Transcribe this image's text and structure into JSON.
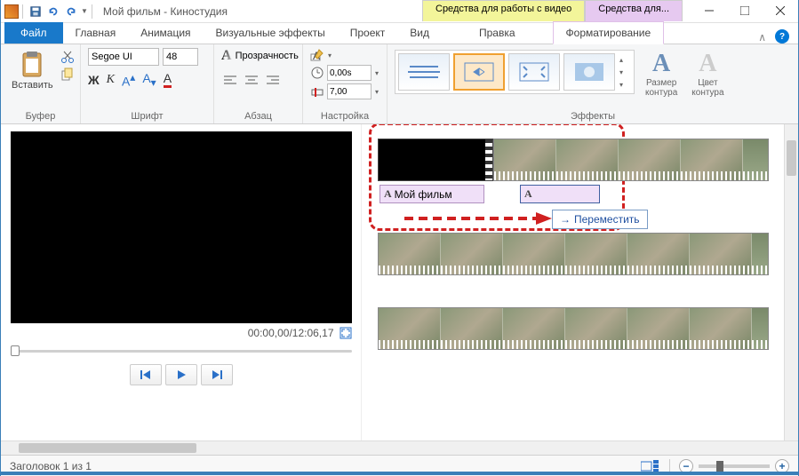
{
  "title": "Мой фильм - Киностудия",
  "context_tabs": {
    "video": "Средства для работы с видео",
    "text": "Средства для..."
  },
  "tabs": {
    "file": "Файл",
    "home": "Главная",
    "anim": "Анимация",
    "vfx": "Визуальные эффекты",
    "project": "Проект",
    "view": "Вид",
    "edit": "Правка",
    "format": "Форматирование"
  },
  "groups": {
    "buffer": "Буфер",
    "font": "Шрифт",
    "para": "Абзац",
    "adjust": "Настройка",
    "effects": "Эффекты"
  },
  "paste": "Вставить",
  "font_name": "Segoe UI",
  "font_size": "48",
  "transparency": "Прозрачность",
  "duration_val": "0,00s",
  "start_val": "7,00",
  "outline_size": "Размер\nконтура",
  "outline_color": "Цвет\nконтура",
  "timecode": "00:00,00/12:06,17",
  "text_clip": "Мой фильм",
  "move_tip": "Переместить",
  "status": "Заголовок 1 из 1"
}
